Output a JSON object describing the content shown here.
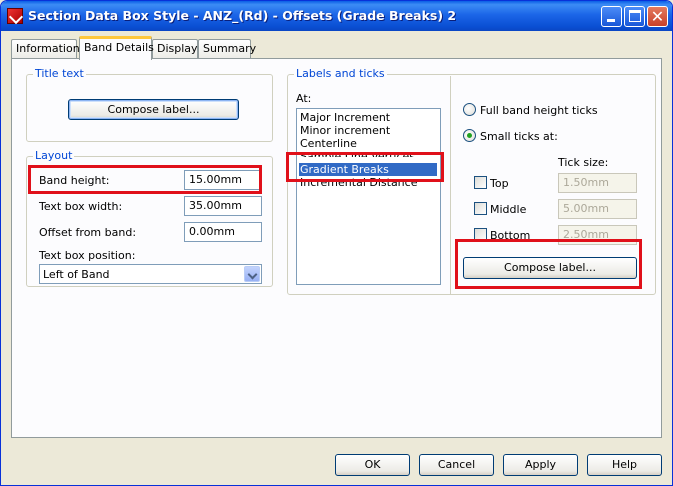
{
  "window": {
    "title": "Section Data Box Style - ANZ_(Rd) - Offsets (Grade Breaks) 2"
  },
  "tabs": [
    "Information",
    "Band Details",
    "Display",
    "Summary"
  ],
  "active_tab": "Band Details",
  "title_text_group": {
    "legend": "Title text",
    "compose_label": "Compose label..."
  },
  "layout_group": {
    "legend": "Layout",
    "band_height_label": "Band height:",
    "band_height_value": "15.00mm",
    "text_box_width_label": "Text box width:",
    "text_box_width_value": "35.00mm",
    "offset_label": "Offset from band:",
    "offset_value": "0.00mm",
    "text_box_position_label": "Text box position:",
    "text_box_position_value": "Left of Band"
  },
  "labels_ticks_group": {
    "legend": "Labels and ticks",
    "at_label": "At:",
    "at_items": [
      "Major Increment",
      "Minor increment",
      "Centerline",
      "Sample Line Vertices",
      "Gradient Breaks",
      "Incremental Distance"
    ],
    "selected_item": "Gradient Breaks",
    "full_band_height_label": "Full band height ticks",
    "small_ticks_label": "Small ticks at:",
    "tick_size_label": "Tick size:",
    "top_label": "Top",
    "top_value": "1.50mm",
    "middle_label": "Middle",
    "middle_value": "5.00mm",
    "bottom_label": "Bottom",
    "bottom_value": "2.50mm",
    "compose_label": "Compose label..."
  },
  "footer": {
    "ok": "OK",
    "cancel": "Cancel",
    "apply": "Apply",
    "help": "Help"
  },
  "colors": {
    "highlight": "#E0101A",
    "selection": "#316AC5",
    "legend": "#0046D5"
  },
  "icons": {
    "app": "autocad-civil-icon",
    "minimize": "minimize-icon",
    "maximize": "maximize-icon",
    "close": "close-icon"
  }
}
